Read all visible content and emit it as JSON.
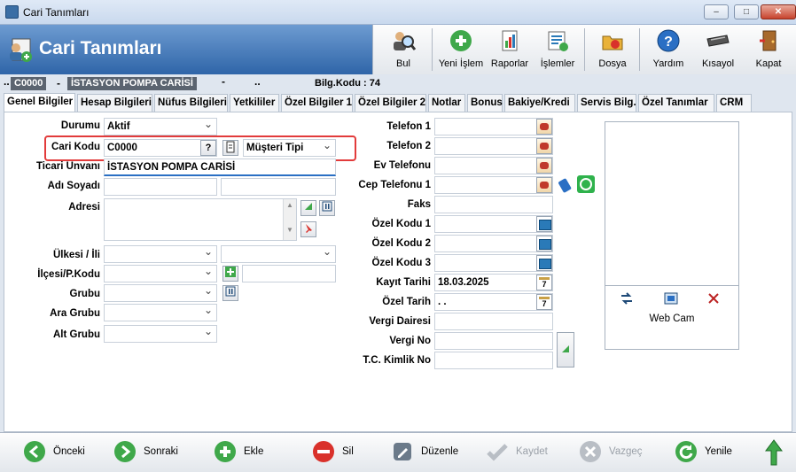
{
  "window": {
    "title": "Cari Tanımları",
    "minimize": "–",
    "maximize": "□",
    "close": "✕"
  },
  "header": {
    "title": "Cari Tanımları"
  },
  "toolbar": {
    "items": [
      {
        "label": "Bul",
        "icon": "search-person-icon"
      },
      {
        "label": "Yeni İşlem",
        "icon": "plus-circle-icon"
      },
      {
        "label": "Raporlar",
        "icon": "report-icon"
      },
      {
        "label": "İşlemler",
        "icon": "transactions-icon"
      },
      {
        "label": "Dosya",
        "icon": "file-icon"
      },
      {
        "label": "Yardım",
        "icon": "help-icon"
      },
      {
        "label": "Kısayol",
        "icon": "keyboard-icon"
      },
      {
        "label": "Kapat",
        "icon": "exit-door-icon"
      }
    ]
  },
  "infobar": {
    "code": "C0000",
    "name": "İSTASYON POMPA CARİSİ",
    "bilg": "Bilg.Kodu : 74"
  },
  "tabs": [
    "Genel Bilgiler",
    "Hesap Bilgileri",
    "Nüfus Bilgileri",
    "Yetkililer",
    "Özel Bilgiler 1",
    "Özel Bilgiler 2",
    "Notlar",
    "Bonus",
    "Bakiye/Kredi",
    "Servis Bilg.",
    "Özel Tanımlar",
    "CRM"
  ],
  "form_left": {
    "durumu_label": "Durumu",
    "durumu_value": "Aktif",
    "cari_kodu_label": "Cari Kodu",
    "cari_kodu_value": "C0000",
    "help_btn": "?",
    "musteri_tipi_value": "Müşteri Tipi",
    "ticari_unvani_label": "Ticari Unvanı",
    "ticari_unvani_value": "İSTASYON POMPA CARİSİ",
    "adi_soyadi_label": "Adı Soyadı",
    "adresi_label": "Adresi",
    "ulkesi_label": "Ülkesi / İli",
    "ilcesi_label": "İlçesi/P.Kodu",
    "grubu_label": "Grubu",
    "ara_grubu_label": "Ara Grubu",
    "alt_grubu_label": "Alt Grubu"
  },
  "form_right": {
    "telefon1_label": "Telefon 1",
    "telefon2_label": "Telefon 2",
    "ev_telefonu_label": "Ev Telefonu",
    "cep_telefonu_label": "Cep Telefonu 1",
    "faks_label": "Faks",
    "ozel_kodu1_label": "Özel Kodu 1",
    "ozel_kodu2_label": "Özel Kodu 2",
    "ozel_kodu3_label": "Özel Kodu 3",
    "kayit_tarihi_label": "Kayıt Tarihi",
    "kayit_tarihi_value": "18.03.2025",
    "ozel_tarih_label": "Özel Tarih",
    "ozel_tarih_value": ". .",
    "vergi_dairesi_label": "Vergi Dairesi",
    "vergi_no_label": "Vergi No",
    "tc_kimlik_label": "T.C. Kimlik No",
    "calendar_glyph": "7"
  },
  "photo": {
    "webcam_label": "Web Cam"
  },
  "bottom": {
    "buttons": [
      {
        "label": "Önceki",
        "color": "#3fa84a",
        "enabled": true
      },
      {
        "label": "Sonraki",
        "color": "#3fa84a",
        "enabled": true
      },
      {
        "label": "Ekle",
        "color": "#3fa84a",
        "enabled": true
      },
      {
        "label": "Sil",
        "color": "#d9312b",
        "enabled": true
      },
      {
        "label": "Düzenle",
        "color": "#6b7a8a",
        "enabled": true
      },
      {
        "label": "Kaydet",
        "color": "#b9bec5",
        "enabled": false
      },
      {
        "label": "Vazgeç",
        "color": "#b9bec5",
        "enabled": false
      },
      {
        "label": "Yenile",
        "color": "#3fa84a",
        "enabled": true
      }
    ]
  },
  "colors": {
    "header_blue": "#2f65a8",
    "highlight_red": "#e23b3b",
    "chip_gray": "#5b6470"
  }
}
